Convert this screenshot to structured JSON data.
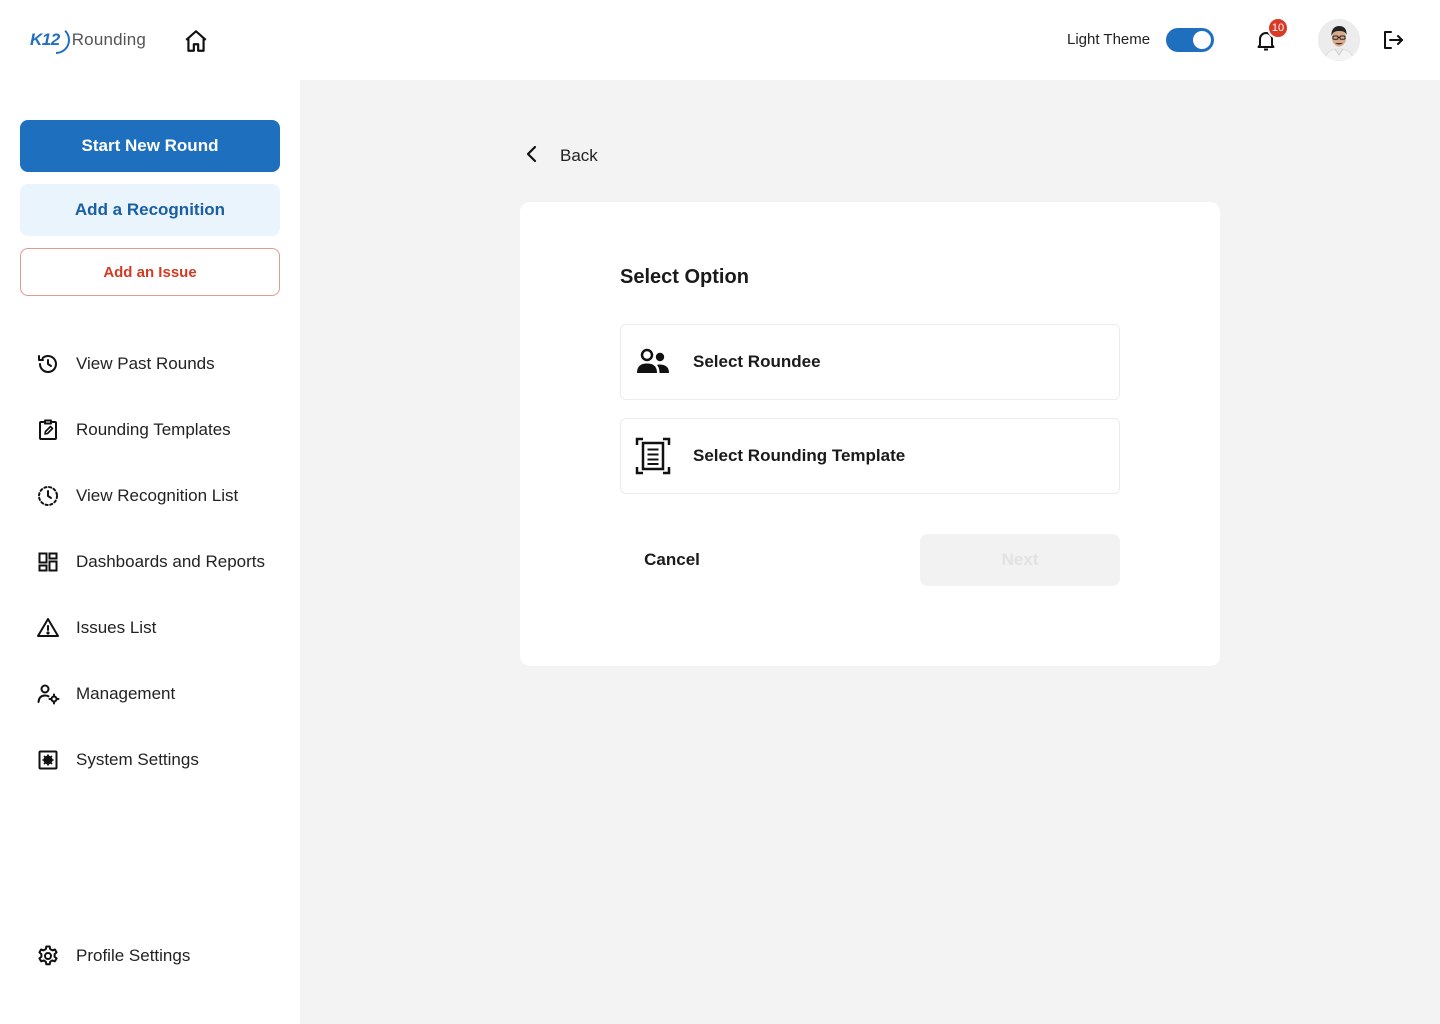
{
  "header": {
    "logo_prefix": "K12",
    "logo_text": "Rounding",
    "theme_label": "Light Theme",
    "theme_toggle_on": true,
    "notification_count": "10",
    "accent_color": "#1f6fbf",
    "badge_color": "#d93a26"
  },
  "sidebar": {
    "start_round_label": "Start New Round",
    "add_recognition_label": "Add a Recognition",
    "add_issue_label": "Add an Issue",
    "nav_items": [
      {
        "label": "View Past Rounds",
        "icon": "history-icon"
      },
      {
        "label": "Rounding Templates",
        "icon": "clipboard-edit-icon"
      },
      {
        "label": "View Recognition List",
        "icon": "dotted-clock-icon"
      },
      {
        "label": "Dashboards and Reports",
        "icon": "dashboard-icon"
      },
      {
        "label": "Issues List",
        "icon": "warning-icon"
      },
      {
        "label": "Management",
        "icon": "user-settings-icon"
      },
      {
        "label": "System Settings",
        "icon": "settings-box-icon"
      }
    ],
    "profile_settings_label": "Profile Settings"
  },
  "main": {
    "back_label": "Back",
    "card": {
      "title": "Select Option",
      "options": [
        {
          "label": "Select Roundee",
          "icon": "users-icon"
        },
        {
          "label": "Select Rounding Template",
          "icon": "document-scan-icon"
        }
      ],
      "cancel_label": "Cancel",
      "next_label": "Next",
      "next_disabled": true
    }
  }
}
